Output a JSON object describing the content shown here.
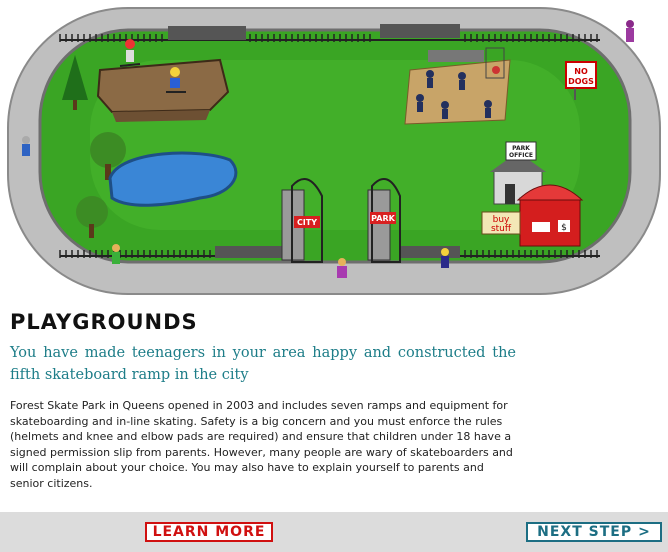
{
  "scene": {
    "signs": {
      "no_dogs": [
        "NO",
        "DOGS"
      ],
      "park_office": [
        "PARK",
        "OFFICE"
      ],
      "buy_stuff": [
        "buy",
        "stuff"
      ],
      "stand_symbol": "$",
      "gate_left": "CITY",
      "gate_right": "PARK"
    }
  },
  "content": {
    "title": "PLAYGROUNDS",
    "subtitle": "You have made teenagers in your area happy and constructed the fifth skateboard ramp in the city",
    "body": "Forest Skate Park in Queens opened in 2003 and includes seven ramps and equipment for skateboarding and in-line skating. Safety is a big concern and you must enforce the rules (helmets and knee and elbow pads are required) and ensure that children under 18 have a signed permission slip from parents. However, many people are wary of skateboarders and will complain about your choice. You may also have to explain yourself to parents and senior citizens."
  },
  "footer": {
    "learn_more": "LEARN MORE",
    "next_step": "NEXT STEP",
    "next_arrow": ">"
  },
  "colors": {
    "grass": "#3aa524",
    "path": "#bcbcbc",
    "subtitle": "#1d7d88",
    "learn_more": "#d01010",
    "next_step": "#1c6e83"
  }
}
